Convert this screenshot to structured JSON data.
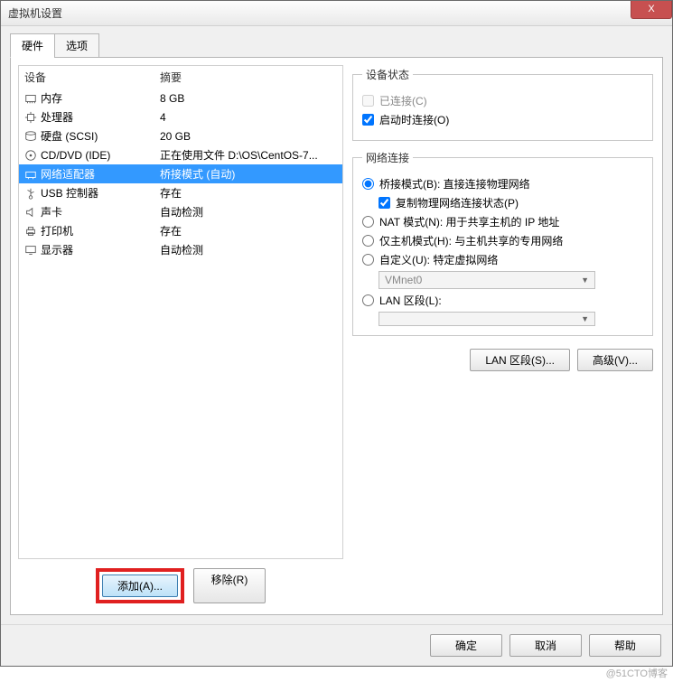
{
  "window": {
    "title": "虚拟机设置"
  },
  "titlebar": {
    "close": "X"
  },
  "tabs": {
    "hardware": "硬件",
    "options": "选项"
  },
  "hwlist": {
    "header_device": "设备",
    "header_summary": "摘要",
    "rows": [
      {
        "icon": "memory-icon",
        "device": "内存",
        "summary": "8 GB"
      },
      {
        "icon": "cpu-icon",
        "device": "处理器",
        "summary": "4"
      },
      {
        "icon": "disk-icon",
        "device": "硬盘 (SCSI)",
        "summary": "20 GB"
      },
      {
        "icon": "cd-icon",
        "device": "CD/DVD (IDE)",
        "summary": "正在使用文件 D:\\OS\\CentOS-7..."
      },
      {
        "icon": "network-icon",
        "device": "网络适配器",
        "summary": "桥接模式 (自动)",
        "selected": true
      },
      {
        "icon": "usb-icon",
        "device": "USB 控制器",
        "summary": "存在"
      },
      {
        "icon": "sound-icon",
        "device": "声卡",
        "summary": "自动检测"
      },
      {
        "icon": "printer-icon",
        "device": "打印机",
        "summary": "存在"
      },
      {
        "icon": "display-icon",
        "device": "显示器",
        "summary": "自动检测"
      }
    ]
  },
  "left_buttons": {
    "add": "添加(A)...",
    "remove": "移除(R)"
  },
  "device_status": {
    "legend": "设备状态",
    "connected": "已连接(C)",
    "connect_at_power_on": "启动时连接(O)"
  },
  "network": {
    "legend": "网络连接",
    "bridged": "桥接模式(B): 直接连接物理网络",
    "replicate": "复制物理网络连接状态(P)",
    "nat": "NAT 模式(N): 用于共享主机的 IP 地址",
    "hostonly": "仅主机模式(H): 与主机共享的专用网络",
    "custom": "自定义(U): 特定虚拟网络",
    "custom_value": "VMnet0",
    "lan": "LAN 区段(L):",
    "lan_value": ""
  },
  "right_buttons": {
    "lan_segments": "LAN 区段(S)...",
    "advanced": "高级(V)..."
  },
  "dialog_buttons": {
    "ok": "确定",
    "cancel": "取消",
    "help": "帮助"
  },
  "watermark": "@51CTO博客"
}
